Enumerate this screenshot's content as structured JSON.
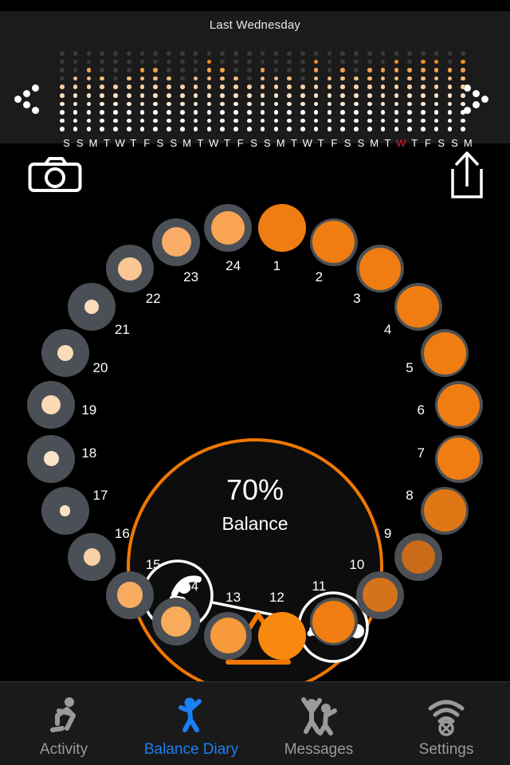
{
  "app": {
    "background": "#000000",
    "accent": "#f07800",
    "active_tab_color": "#1b7ff5"
  },
  "header": {
    "title": "Last Wednesday",
    "prev_label": "Previous",
    "next_label": "Next"
  },
  "history_chart": {
    "rows": 10,
    "columns": 30,
    "day_labels": [
      "S",
      "S",
      "M",
      "T",
      "W",
      "T",
      "F",
      "S",
      "S",
      "M",
      "T",
      "W",
      "T",
      "F",
      "S",
      "S",
      "M",
      "T",
      "W",
      "T",
      "F",
      "S",
      "S",
      "M",
      "T",
      "W",
      "T",
      "F",
      "S",
      "S",
      "M"
    ],
    "highlighted_day_index": 25,
    "highlighted_day_color": "#e02020",
    "column_values": [
      6,
      7,
      8,
      7,
      6,
      7,
      8,
      8,
      7,
      6,
      7,
      9,
      8,
      7,
      6,
      8,
      7,
      7,
      6,
      9,
      7,
      8,
      7,
      8,
      8,
      10,
      8,
      9,
      10,
      8,
      10
    ],
    "level_colors": [
      "#3a3a3a",
      "#f08c1e",
      "#f0a04a",
      "#f4bb7e",
      "#f7d0a4",
      "#fadfc2",
      "#fcebd8",
      "#ffffff",
      "#ffffff",
      "#ffffff"
    ]
  },
  "actions": {
    "camera": {
      "icon": "camera-icon",
      "label": "Camera"
    },
    "share": {
      "icon": "share-icon",
      "label": "Share"
    }
  },
  "dial": {
    "center": {
      "percent": "70%",
      "label": "Balance",
      "ring_color": "#f07800",
      "left_icon": "stretching-figure-icon",
      "right_icon": "reclining-figure-icon",
      "fulcrum_icon": "triangle-fulcrum-icon"
    },
    "nodes": [
      {
        "label": "1",
        "fill": "#ef7d11",
        "fill_ratio": 1.0,
        "ring": false
      },
      {
        "label": "2",
        "fill": "#ef7d11",
        "fill_ratio": 1.0,
        "ring": true
      },
      {
        "label": "3",
        "fill": "#ef7d11",
        "fill_ratio": 1.0,
        "ring": true
      },
      {
        "label": "4",
        "fill": "#ef7d11",
        "fill_ratio": 1.0,
        "ring": true
      },
      {
        "label": "5",
        "fill": "#ef7d11",
        "fill_ratio": 1.0,
        "ring": true
      },
      {
        "label": "6",
        "fill": "#ef7d11",
        "fill_ratio": 1.0,
        "ring": true
      },
      {
        "label": "7",
        "fill": "#ef7d11",
        "fill_ratio": 1.0,
        "ring": true
      },
      {
        "label": "8",
        "fill": "#e07714",
        "fill_ratio": 1.0,
        "ring": true
      },
      {
        "label": "9",
        "fill": "#c96b18",
        "fill_ratio": 0.8,
        "ring": true
      },
      {
        "label": "10",
        "fill": "#d5731a",
        "fill_ratio": 0.82,
        "ring": true
      },
      {
        "label": "11",
        "fill": "#ef7d11",
        "fill_ratio": 1.0,
        "ring": true
      },
      {
        "label": "12",
        "fill": "#f8890f",
        "fill_ratio": 1.0,
        "ring": false
      },
      {
        "label": "13",
        "fill": "#f79a3c",
        "fill_ratio": 0.86,
        "ring": true
      },
      {
        "label": "14",
        "fill": "#f9ab5c",
        "fill_ratio": 0.72,
        "ring": true
      },
      {
        "label": "15",
        "fill": "#f7ac61",
        "fill_ratio": 0.62,
        "ring": true
      },
      {
        "label": "16",
        "fill": "#f9d0a6",
        "fill_ratio": 0.4,
        "ring": true
      },
      {
        "label": "17",
        "fill": "#fae2c6",
        "fill_ratio": 0.26,
        "ring": true
      },
      {
        "label": "18",
        "fill": "#fbe3c8",
        "fill_ratio": 0.36,
        "ring": true
      },
      {
        "label": "19",
        "fill": "#fbd9b4",
        "fill_ratio": 0.46,
        "ring": true
      },
      {
        "label": "20",
        "fill": "#fbdcb8",
        "fill_ratio": 0.38,
        "ring": true
      },
      {
        "label": "21",
        "fill": "#fadcbb",
        "fill_ratio": 0.34,
        "ring": true
      },
      {
        "label": "22",
        "fill": "#f9c694",
        "fill_ratio": 0.56,
        "ring": true
      },
      {
        "label": "23",
        "fill": "#f9ad68",
        "fill_ratio": 0.7,
        "ring": true
      },
      {
        "label": "24",
        "fill": "#f9a452",
        "fill_ratio": 0.8,
        "ring": true
      }
    ]
  },
  "tabbar": {
    "items": [
      {
        "label": "Activity",
        "icon": "running-figure-icon",
        "active": false
      },
      {
        "label": "Balance Diary",
        "icon": "jumping-figure-icon",
        "active": true
      },
      {
        "label": "Messages",
        "icon": "two-figures-icon",
        "active": false
      },
      {
        "label": "Settings",
        "icon": "signal-off-icon",
        "active": false
      }
    ]
  }
}
